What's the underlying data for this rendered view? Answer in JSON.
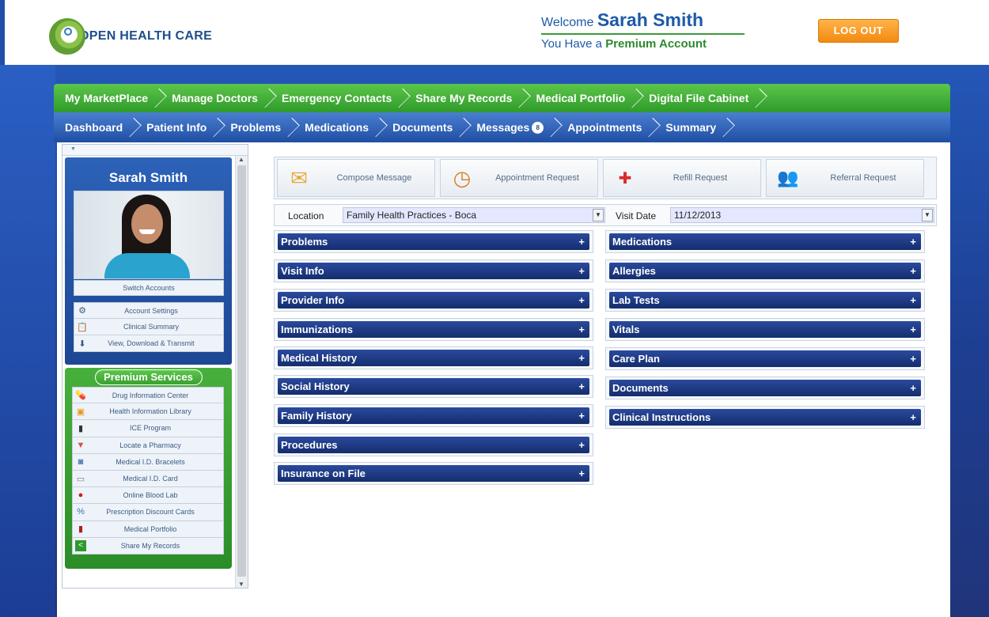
{
  "brand": {
    "name": "OPEN HEALTH CARE"
  },
  "welcome": {
    "prefix": "Welcome ",
    "user_name": "Sarah Smith",
    "account_prefix": "You Have a ",
    "account_type": "Premium Account"
  },
  "logout_label": "LOG OUT",
  "nav_top": [
    {
      "label": "My MarketPlace"
    },
    {
      "label": "Manage Doctors"
    },
    {
      "label": "Emergency Contacts"
    },
    {
      "label": "Share My Records"
    },
    {
      "label": "Medical Portfolio"
    },
    {
      "label": "Digital File Cabinet"
    }
  ],
  "nav_bottom": [
    {
      "label": "Dashboard"
    },
    {
      "label": "Patient Info"
    },
    {
      "label": "Problems"
    },
    {
      "label": "Medications"
    },
    {
      "label": "Documents"
    },
    {
      "label": "Messages",
      "badge": "8"
    },
    {
      "label": "Appointments"
    },
    {
      "label": "Summary"
    }
  ],
  "sidebar": {
    "profile_name": "Sarah Smith",
    "switch_accounts": "Switch Accounts",
    "account_items": [
      {
        "label": "Account Settings",
        "icon": "settings-icon"
      },
      {
        "label": "Clinical Summary",
        "icon": "clipboard-icon"
      },
      {
        "label": "View, Download & Transmit",
        "icon": "download-icon"
      }
    ],
    "premium_title": "Premium Services",
    "premium_items": [
      {
        "label": "Drug Information Center",
        "icon": "pill-icon"
      },
      {
        "label": "Health Information Library",
        "icon": "library-icon"
      },
      {
        "label": "ICE Program",
        "icon": "phone-icon"
      },
      {
        "label": "Locate a Pharmacy",
        "icon": "pharmacy-icon"
      },
      {
        "label": "Medical I.D. Bracelets",
        "icon": "bracelet-icon"
      },
      {
        "label": "Medical I.D. Card",
        "icon": "card-icon"
      },
      {
        "label": "Online Blood Lab",
        "icon": "blood-drop-icon"
      },
      {
        "label": "Prescription Discount Cards",
        "icon": "discount-icon"
      },
      {
        "label": "Medical Portfolio",
        "icon": "book-icon"
      },
      {
        "label": "Share My Records",
        "icon": "share-icon"
      }
    ]
  },
  "actions": [
    {
      "label": "Compose Message",
      "icon": "envelope-icon"
    },
    {
      "label": "Appointment Request",
      "icon": "clock-icon"
    },
    {
      "label": "Refill Request",
      "icon": "medicine-bottle-icon"
    },
    {
      "label": "Referral Request",
      "icon": "people-icon"
    }
  ],
  "filters": {
    "location_label": "Location",
    "location_value": "Family Health Practices - Boca",
    "visit_date_label": "Visit Date",
    "visit_date_value": "11/12/2013"
  },
  "sections_left": [
    "Problems",
    "Visit Info",
    "Provider Info",
    "Immunizations",
    "Medical History",
    "Social History",
    "Family History",
    "Procedures",
    "Insurance on File"
  ],
  "sections_right": [
    "Medications",
    "Allergies",
    "Lab Tests",
    "Vitals",
    "Care Plan",
    "Documents",
    "Clinical Instructions"
  ],
  "colors": {
    "nav_green": "#3aa832",
    "nav_blue": "#1f4ea3",
    "section_navy": "#142d6d",
    "logout_orange": "#f28a12"
  }
}
